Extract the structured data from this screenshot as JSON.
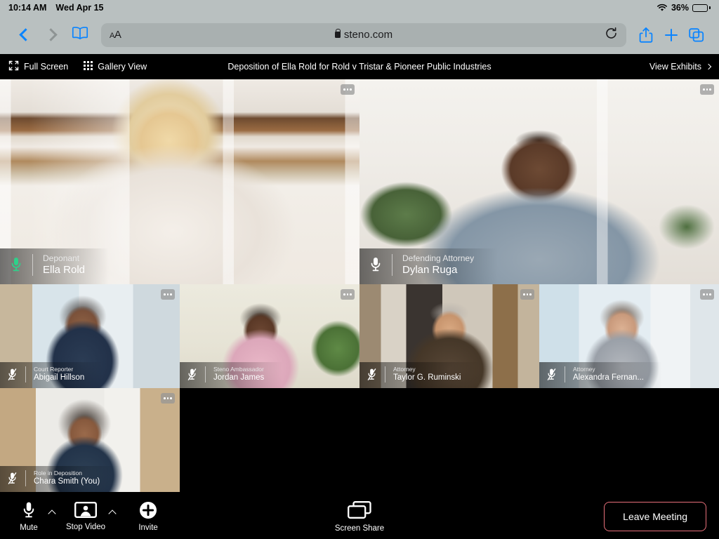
{
  "status_bar": {
    "time": "10:14 AM",
    "date": "Wed Apr 15",
    "wifi_icon": "wifi-icon",
    "battery_percent": "36%"
  },
  "browser": {
    "back_icon": "chevron-left-icon",
    "forward_icon": "chevron-right-icon",
    "bookmarks_icon": "book-icon",
    "text_size_label": "AA",
    "lock_icon": "lock-icon",
    "url": "steno.com",
    "reload_icon": "reload-icon",
    "share_icon": "share-icon",
    "new_tab_icon": "plus-icon",
    "tabs_icon": "tabs-icon"
  },
  "meeting_header": {
    "full_screen_label": "Full Screen",
    "full_screen_icon": "expand-icon",
    "gallery_view_label": "Gallery View",
    "gallery_view_icon": "grid-icon",
    "title": "Deposition of Ella Rold for Rold v Tristar & Pioneer Public Industries",
    "view_exhibits_label": "View Exhibits",
    "view_exhibits_icon": "chevron-right-icon"
  },
  "participants": [
    {
      "role": "Deponant",
      "name": "Ella Rold",
      "mic": "unmuted",
      "mic_color": "#2fd08a",
      "active_speaker": true,
      "more_icon": "more-options-icon"
    },
    {
      "role": "Defending Attorney",
      "name": "Dylan Ruga",
      "mic": "unmuted",
      "mic_color": "#ffffff",
      "active_speaker": false,
      "more_icon": "more-options-icon"
    },
    {
      "role": "Court Reporter",
      "name": "Abigail Hillson",
      "mic": "muted",
      "mic_color": "#ffffff",
      "active_speaker": false,
      "more_icon": "more-options-icon"
    },
    {
      "role": "Steno Ambassador",
      "name": "Jordan James",
      "mic": "muted",
      "mic_color": "#ffffff",
      "active_speaker": false,
      "more_icon": "more-options-icon"
    },
    {
      "role": "Attorney",
      "name": "Taylor G. Ruminski",
      "mic": "muted",
      "mic_color": "#ffffff",
      "active_speaker": false,
      "more_icon": "more-options-icon"
    },
    {
      "role": "Attorney",
      "name": "Alexandra Fernan...",
      "mic": "muted",
      "mic_color": "#ffffff",
      "active_speaker": false,
      "more_icon": "more-options-icon"
    },
    {
      "role": "Role in Deposition",
      "name": "Chara Smith (You)",
      "mic": "muted",
      "mic_color": "#ffffff",
      "active_speaker": false,
      "more_icon": "more-options-icon"
    }
  ],
  "controls": {
    "mute_label": "Mute",
    "mute_icon": "microphone-icon",
    "mute_caret_icon": "chevron-up-icon",
    "video_label": "Stop Video",
    "video_icon": "camera-icon",
    "video_caret_icon": "chevron-up-icon",
    "invite_label": "Invite",
    "invite_icon": "plus-circle-icon",
    "screen_share_label": "Screen Share",
    "screen_share_icon": "screen-share-icon",
    "leave_label": "Leave Meeting"
  },
  "colors": {
    "active_speaker": "#22c88a",
    "leave_border": "#e8707a",
    "chrome": "#b9c0c0",
    "accent_blue": "#0a84ff"
  }
}
